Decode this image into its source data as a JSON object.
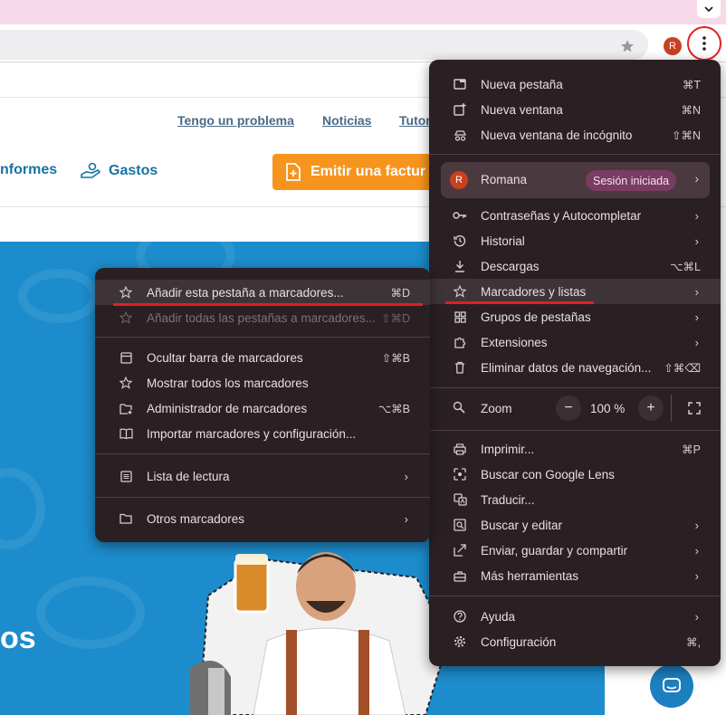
{
  "browser": {
    "profile_initial": "R",
    "menu_icon": "three-dots-vertical-icon",
    "accent_highlight": "#e02020"
  },
  "site": {
    "top_links": [
      "Tengo un problema",
      "Noticias",
      "Tutor"
    ],
    "nav": {
      "informes": "nformes",
      "gastos": "Gastos"
    },
    "emit_button": "Emitir una factur",
    "hero_text": "os",
    "hero_color": "#1c8ccc"
  },
  "main_menu": {
    "new_tab": {
      "label": "Nueva pestaña",
      "shortcut": "⌘T"
    },
    "new_window": {
      "label": "Nueva ventana",
      "shortcut": "⌘N"
    },
    "incognito": {
      "label": "Nueva ventana de incógnito",
      "shortcut": "⇧⌘N"
    },
    "profile": {
      "initial": "R",
      "name": "Romana",
      "status": "Sesión iniciada"
    },
    "passwords": {
      "label": "Contraseñas y Autocompletar"
    },
    "history": {
      "label": "Historial"
    },
    "downloads": {
      "label": "Descargas",
      "shortcut": "⌥⌘L"
    },
    "bookmarks": {
      "label": "Marcadores y listas"
    },
    "tab_groups": {
      "label": "Grupos de pestañas"
    },
    "extensions": {
      "label": "Extensiones"
    },
    "clear_data": {
      "label": "Eliminar datos de navegación...",
      "shortcut": "⇧⌘⌫"
    },
    "zoom": {
      "label": "Zoom",
      "minus": "−",
      "value": "100 %",
      "plus": "+"
    },
    "print": {
      "label": "Imprimir...",
      "shortcut": "⌘P"
    },
    "lens": {
      "label": "Buscar con Google Lens"
    },
    "translate": {
      "label": "Traducir..."
    },
    "find_edit": {
      "label": "Buscar y editar"
    },
    "cast_save_share": {
      "label": "Enviar, guardar y compartir"
    },
    "more_tools": {
      "label": "Más herramientas"
    },
    "help": {
      "label": "Ayuda"
    },
    "settings": {
      "label": "Configuración",
      "shortcut": "⌘,"
    }
  },
  "bookmarks_submenu": {
    "add_tab": {
      "label": "Añadir esta pestaña a marcadores...",
      "shortcut": "⌘D"
    },
    "add_all": {
      "label": "Añadir todas las pestañas a marcadores...",
      "shortcut": "⇧⌘D"
    },
    "hide_bar": {
      "label": "Ocultar barra de marcadores",
      "shortcut": "⇧⌘B"
    },
    "show_all": {
      "label": "Mostrar todos los marcadores"
    },
    "manager": {
      "label": "Administrador de marcadores",
      "shortcut": "⌥⌘B"
    },
    "import": {
      "label": "Importar marcadores y configuración..."
    },
    "reading_list": {
      "label": "Lista de lectura"
    },
    "other": {
      "label": "Otros marcadores"
    }
  }
}
